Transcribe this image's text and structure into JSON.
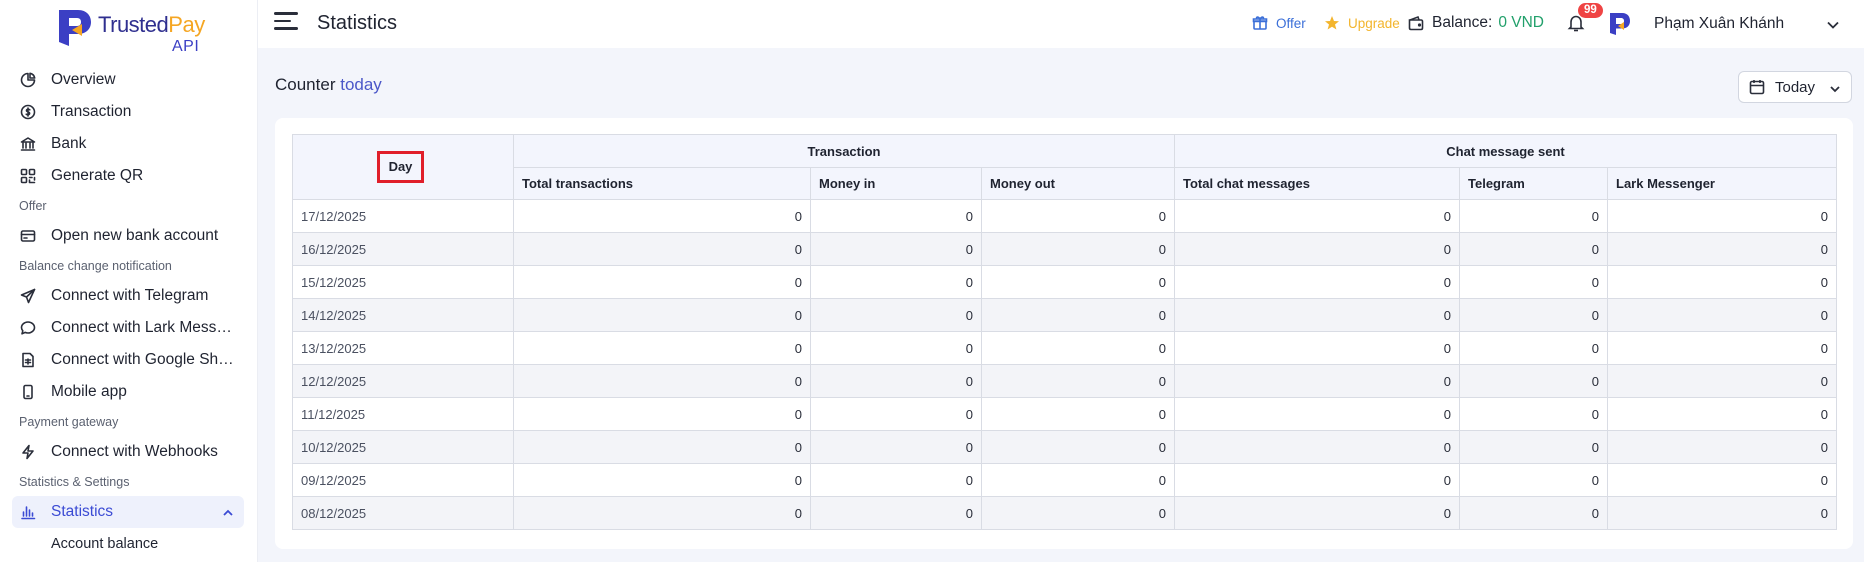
{
  "brand": {
    "name_part1": "Trusted",
    "name_part2": "Pay",
    "sub": "API"
  },
  "header": {
    "title": "Statistics",
    "offer": "Offer",
    "upgrade": "Upgrade",
    "balance_label": "Balance:",
    "balance_value": "0 VND",
    "notification_count": "99",
    "user_name": "Phạm Xuân Khánh"
  },
  "sidebar": {
    "items": [
      {
        "type": "item",
        "label": "Overview",
        "icon": "pie-chart-icon"
      },
      {
        "type": "item",
        "label": "Transaction",
        "icon": "coin-icon"
      },
      {
        "type": "item",
        "label": "Bank",
        "icon": "bank-icon"
      },
      {
        "type": "item",
        "label": "Generate QR",
        "icon": "qr-icon"
      },
      {
        "type": "section",
        "label": "Offer"
      },
      {
        "type": "item",
        "label": "Open new bank account",
        "icon": "card-plus-icon"
      },
      {
        "type": "section",
        "label": "Balance change notification"
      },
      {
        "type": "item",
        "label": "Connect with Telegram",
        "icon": "send-icon"
      },
      {
        "type": "item",
        "label": "Connect with Lark Messenger",
        "icon": "chat-icon"
      },
      {
        "type": "item",
        "label": "Connect with Google Sheets",
        "icon": "sheet-icon"
      },
      {
        "type": "item",
        "label": "Mobile app",
        "icon": "mobile-icon"
      },
      {
        "type": "section",
        "label": "Payment gateway"
      },
      {
        "type": "item",
        "label": "Connect with Webhooks",
        "icon": "bolt-icon"
      },
      {
        "type": "section",
        "label": "Statistics & Settings"
      },
      {
        "type": "active",
        "label": "Statistics",
        "icon": "bar-chart-icon"
      },
      {
        "type": "sub",
        "label": "Account balance"
      }
    ]
  },
  "main": {
    "counter_prefix": "Counter",
    "counter_highlight": "today",
    "date_filter": "Today",
    "table": {
      "day_header": "Day",
      "group_transaction": "Transaction",
      "group_chat": "Chat message sent",
      "columns": [
        "Total transactions",
        "Money in",
        "Money out",
        "Total chat messages",
        "Telegram",
        "Lark Messenger"
      ],
      "rows": [
        [
          "17/12/2025",
          "0",
          "0",
          "0",
          "0",
          "0",
          "0"
        ],
        [
          "16/12/2025",
          "0",
          "0",
          "0",
          "0",
          "0",
          "0"
        ],
        [
          "15/12/2025",
          "0",
          "0",
          "0",
          "0",
          "0",
          "0"
        ],
        [
          "14/12/2025",
          "0",
          "0",
          "0",
          "0",
          "0",
          "0"
        ],
        [
          "13/12/2025",
          "0",
          "0",
          "0",
          "0",
          "0",
          "0"
        ],
        [
          "12/12/2025",
          "0",
          "0",
          "0",
          "0",
          "0",
          "0"
        ],
        [
          "11/12/2025",
          "0",
          "0",
          "0",
          "0",
          "0",
          "0"
        ],
        [
          "10/12/2025",
          "0",
          "0",
          "0",
          "0",
          "0",
          "0"
        ],
        [
          "09/12/2025",
          "0",
          "0",
          "0",
          "0",
          "0",
          "0"
        ],
        [
          "08/12/2025",
          "0",
          "0",
          "0",
          "0",
          "0",
          "0"
        ]
      ]
    }
  },
  "colors": {
    "accent": "#3b4bd4",
    "balance_green": "#22a06b",
    "upgrade_gold": "#f3b52d",
    "badge_red": "#ef4444",
    "highlight_box": "#e01e2a"
  }
}
